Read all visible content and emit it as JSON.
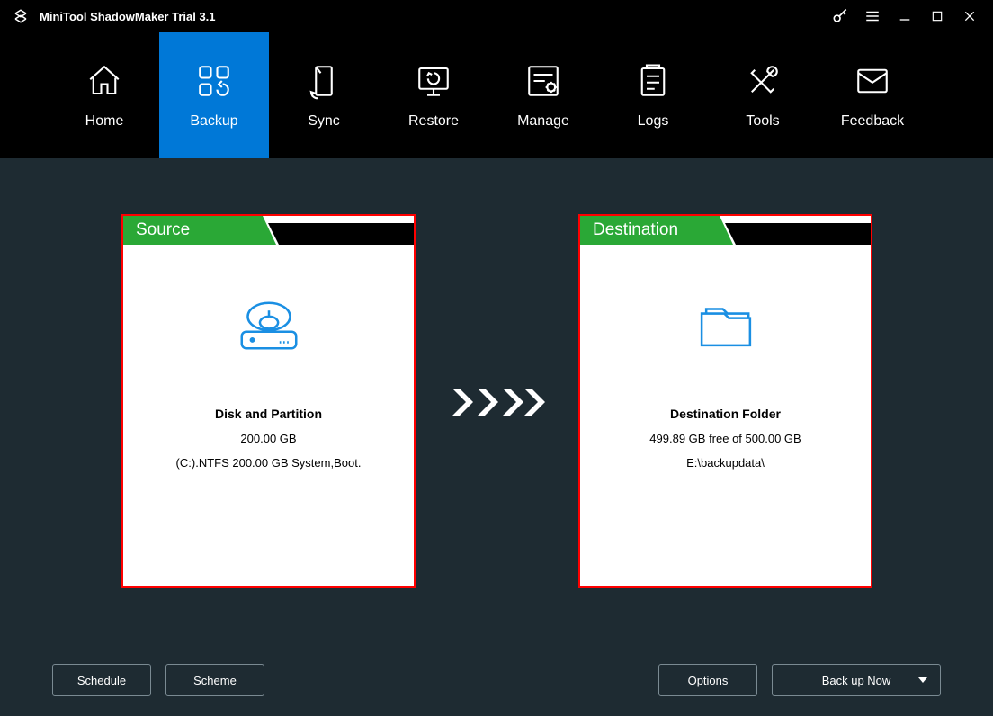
{
  "app": {
    "title": "MiniTool ShadowMaker Trial 3.1"
  },
  "tabs": [
    {
      "label": "Home"
    },
    {
      "label": "Backup"
    },
    {
      "label": "Sync"
    },
    {
      "label": "Restore"
    },
    {
      "label": "Manage"
    },
    {
      "label": "Logs"
    },
    {
      "label": "Tools"
    },
    {
      "label": "Feedback"
    }
  ],
  "source": {
    "header": "Source",
    "title": "Disk and Partition",
    "line1": "200.00 GB",
    "line2": "(C:).NTFS 200.00 GB System,Boot."
  },
  "destination": {
    "header": "Destination",
    "title": "Destination Folder",
    "line1": "499.89 GB free of 500.00 GB",
    "line2": "E:\\backupdata\\"
  },
  "buttons": {
    "schedule": "Schedule",
    "scheme": "Scheme",
    "options": "Options",
    "backup_now": "Back up Now"
  }
}
